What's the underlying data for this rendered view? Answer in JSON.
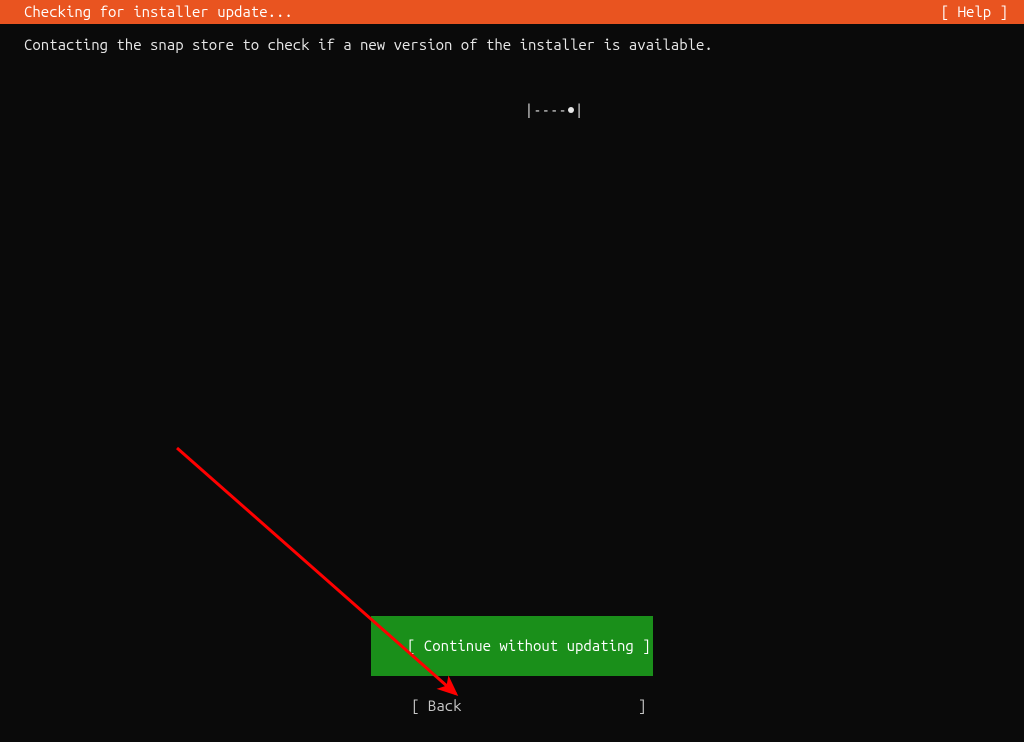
{
  "header": {
    "title": "Checking for installer update...",
    "help": "[ Help ]"
  },
  "body": {
    "status_text": "Contacting the snap store to check if a new version of the installer is available.",
    "spinner_left": "|----",
    "spinner_right": "|"
  },
  "footer": {
    "continue_pre": "[ ",
    "continue_label": "Continue without updating",
    "continue_post": " ]",
    "back_pre": "[ ",
    "back_label": "Back",
    "back_post": "                     ]"
  },
  "annotation": {
    "arrow_color": "#ff0000"
  }
}
